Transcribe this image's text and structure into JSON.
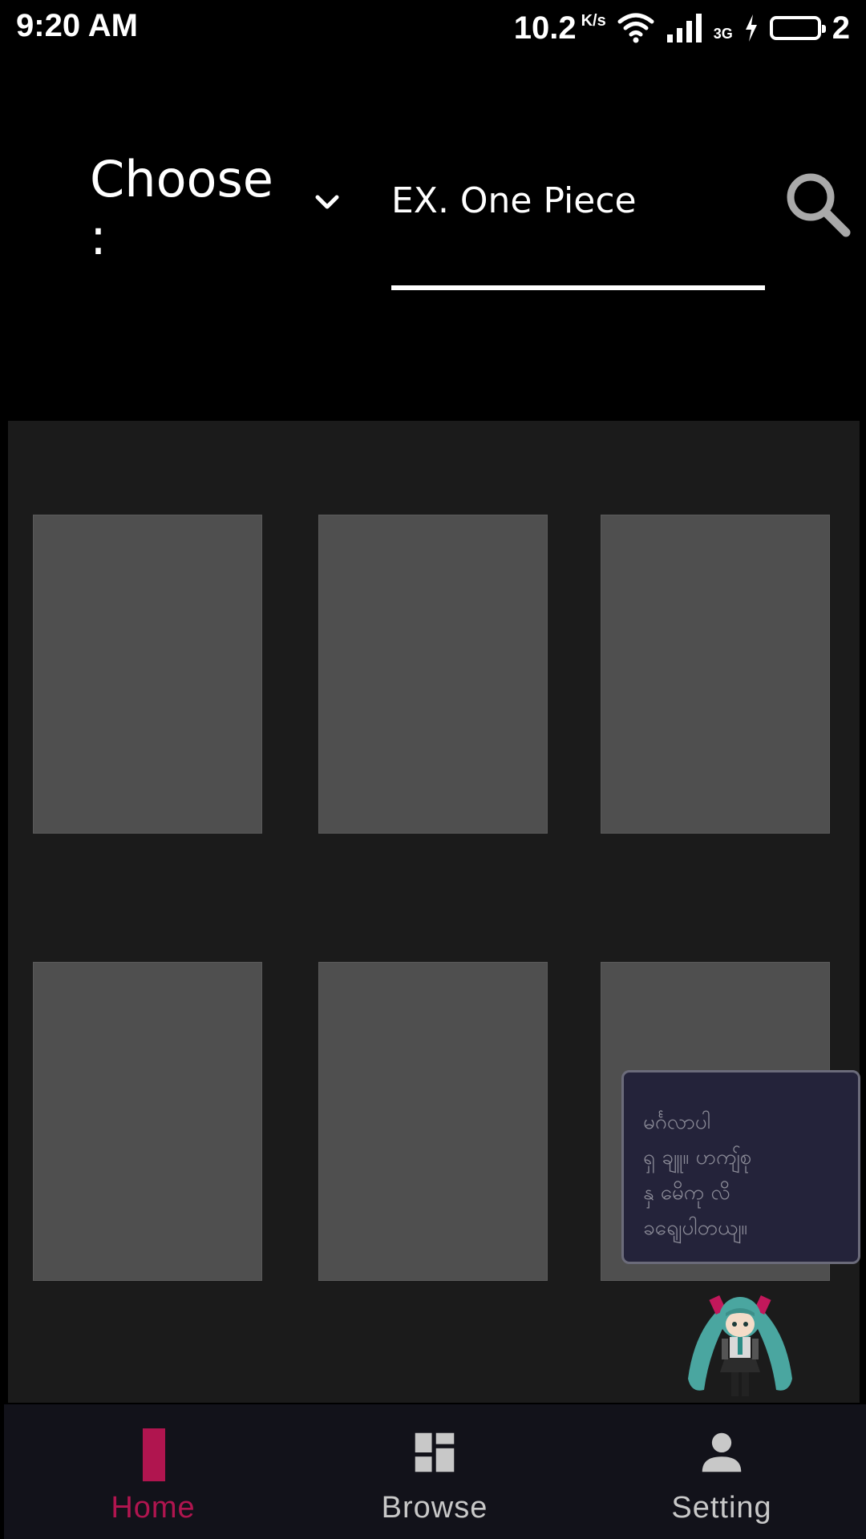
{
  "status_bar": {
    "time": "9:20 AM",
    "net_speed": "10.2",
    "net_unit": "K/s",
    "network_type": "3G",
    "battery_level": "2"
  },
  "header": {
    "choose_label": "Choose\n:",
    "search_placeholder": "EX. One Piece",
    "icons": {
      "dropdown": "chevron-down-icon",
      "search": "search-icon"
    }
  },
  "grid": {
    "cards": [
      "",
      "",
      "",
      "",
      "",
      ""
    ]
  },
  "tooltip": {
    "text": "မင်္ဂလာပါ\nရှ ချူ။ ဟကျ်စု\nနှ မေိကု လိ\nခရျေပါတယျ။"
  },
  "bottom_nav": {
    "items": [
      {
        "label": "Home",
        "icon": "home-icon",
        "active": true
      },
      {
        "label": "Browse",
        "icon": "dashboard-icon",
        "active": false
      },
      {
        "label": "Setting",
        "icon": "person-icon",
        "active": false
      }
    ],
    "active_color": "#b0154f",
    "inactive_color": "#c8c8c8"
  }
}
